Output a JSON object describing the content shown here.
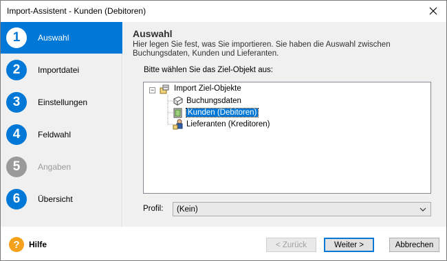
{
  "window": {
    "title": "Import-Assistent - Kunden (Debitoren)"
  },
  "steps": [
    {
      "number": "1",
      "label": "Auswahl",
      "state": "active"
    },
    {
      "number": "2",
      "label": "Importdatei",
      "state": "normal"
    },
    {
      "number": "3",
      "label": "Einstellungen",
      "state": "normal"
    },
    {
      "number": "4",
      "label": "Feldwahl",
      "state": "normal"
    },
    {
      "number": "5",
      "label": "Angaben",
      "state": "disabled"
    },
    {
      "number": "6",
      "label": "Übersicht",
      "state": "normal"
    }
  ],
  "main": {
    "title": "Auswahl",
    "description": "Hier legen Sie fest, was Sie importieren. Sie haben die Auswahl zwischen Buchungsdaten, Kunden und Lieferanten.",
    "prompt": "Bitte wählen Sie das Ziel-Objekt aus:",
    "tree": {
      "root": {
        "label": "Import Ziel-Objekte",
        "expander": "−",
        "icon": "folder-boxes-icon"
      },
      "children": [
        {
          "label": "Buchungsdaten",
          "icon": "book-icon",
          "selected": false
        },
        {
          "label": "Kunden (Debitoren)",
          "icon": "customer-card-icon",
          "selected": true
        },
        {
          "label": "Lieferanten (Kreditoren)",
          "icon": "supplier-person-icon",
          "selected": false
        }
      ]
    },
    "profil": {
      "label": "Profil:",
      "value": "(Kein)"
    }
  },
  "footer": {
    "help_label": "Hilfe",
    "help_icon": "?",
    "back_label": "< Zurück",
    "next_label": "Weiter >",
    "cancel_label": "Abbrechen"
  },
  "colors": {
    "accent": "#0078d7",
    "disabled": "#9a9a9a",
    "help": "#f4a11b"
  }
}
